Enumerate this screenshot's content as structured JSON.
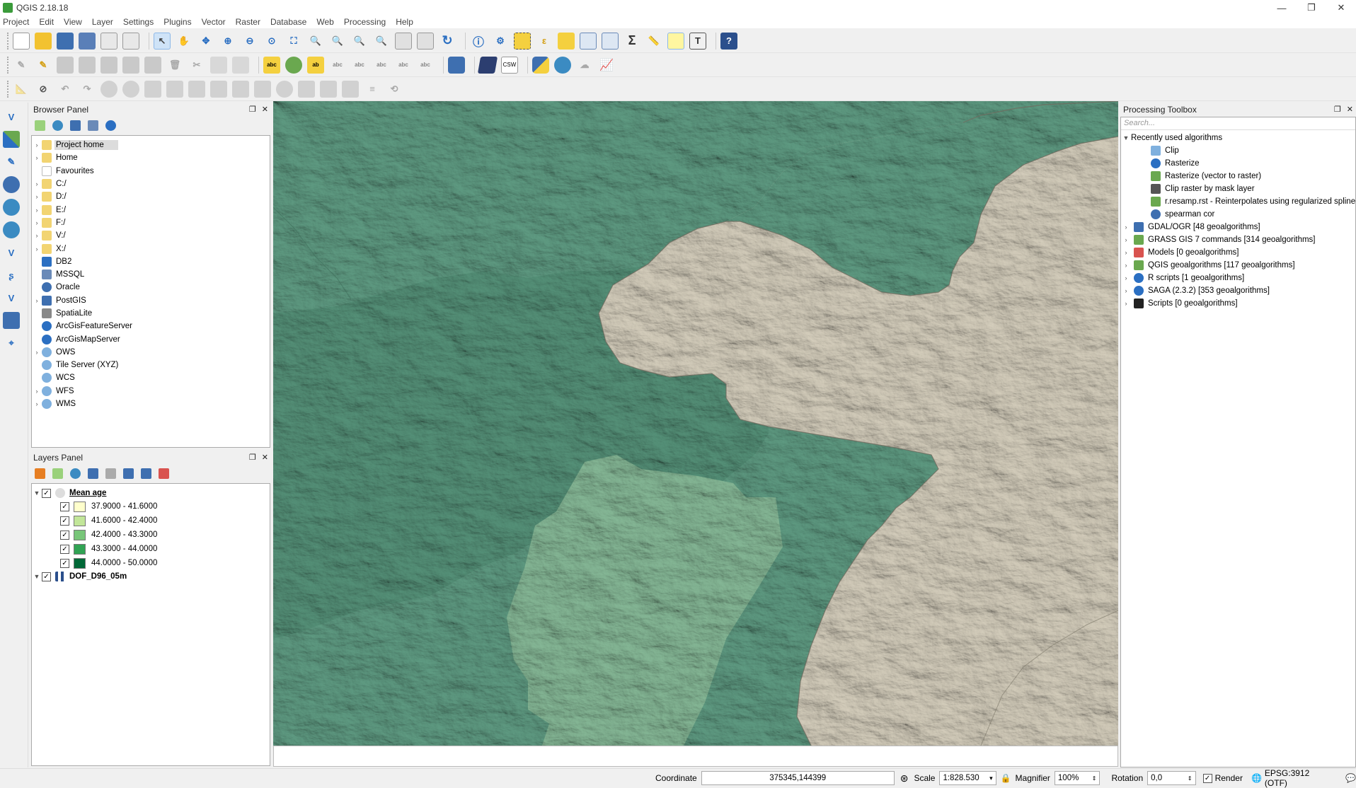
{
  "window": {
    "title": "QGIS 2.18.18",
    "minimize": "—",
    "restore": "❐",
    "close": "✕"
  },
  "menu": [
    "Project",
    "Edit",
    "View",
    "Layer",
    "Settings",
    "Plugins",
    "Vector",
    "Raster",
    "Database",
    "Web",
    "Processing",
    "Help"
  ],
  "toolbar": {
    "csw_label": "CSW",
    "abc_label": "abc"
  },
  "browser": {
    "title": "Browser Panel",
    "items": [
      {
        "label": "Project home",
        "icon": "folder-icon",
        "expandable": true
      },
      {
        "label": "Home",
        "icon": "folder-icon",
        "expandable": true
      },
      {
        "label": "Favourites",
        "icon": "star-icon",
        "expandable": false
      },
      {
        "label": "C:/",
        "icon": "folder-icon",
        "expandable": true
      },
      {
        "label": "D:/",
        "icon": "folder-icon",
        "expandable": true
      },
      {
        "label": "E:/",
        "icon": "folder-icon",
        "expandable": true
      },
      {
        "label": "F:/",
        "icon": "folder-icon",
        "expandable": true
      },
      {
        "label": "V:/",
        "icon": "folder-icon",
        "expandable": true
      },
      {
        "label": "X:/",
        "icon": "folder-icon",
        "expandable": true
      },
      {
        "label": "DB2",
        "icon": "db2-icon",
        "expandable": false
      },
      {
        "label": "MSSQL",
        "icon": "mssql-icon",
        "expandable": false
      },
      {
        "label": "Oracle",
        "icon": "oracle-icon",
        "expandable": false
      },
      {
        "label": "PostGIS",
        "icon": "postgis-icon",
        "expandable": true
      },
      {
        "label": "SpatiaLite",
        "icon": "spatialite-icon",
        "expandable": false
      },
      {
        "label": "ArcGisFeatureServer",
        "icon": "arcgis-icon",
        "expandable": false
      },
      {
        "label": "ArcGisMapServer",
        "icon": "arcgis-icon",
        "expandable": false
      },
      {
        "label": "OWS",
        "icon": "globe-icon",
        "expandable": true
      },
      {
        "label": "Tile Server (XYZ)",
        "icon": "globe-icon",
        "expandable": false
      },
      {
        "label": "WCS",
        "icon": "globe-icon",
        "expandable": false
      },
      {
        "label": "WFS",
        "icon": "globe-icon",
        "expandable": true
      },
      {
        "label": "WMS",
        "icon": "globe-icon",
        "expandable": true
      }
    ]
  },
  "layers": {
    "title": "Layers Panel",
    "group": {
      "name": "Mean age"
    },
    "classes": [
      {
        "label": "37.9000 - 41.6000",
        "color": "#ffffcc"
      },
      {
        "label": "41.6000 - 42.4000",
        "color": "#c2e699"
      },
      {
        "label": "42.4000 - 43.3000",
        "color": "#78c679"
      },
      {
        "label": "43.3000 - 44.0000",
        "color": "#31a354"
      },
      {
        "label": "44.0000 - 50.0000",
        "color": "#006837"
      }
    ],
    "raster": {
      "name": "DOF_D96_05m"
    }
  },
  "processing": {
    "title": "Processing Toolbox",
    "search_placeholder": "Search...",
    "recent": {
      "label": "Recently used algorithms",
      "items": [
        "Clip",
        "Rasterize",
        "Rasterize (vector to raster)",
        "Clip raster by mask layer",
        "r.resamp.rst - Reinterpolates using regularized spline ...",
        "spearman cor"
      ]
    },
    "providers": [
      "GDAL/OGR [48 geoalgorithms]",
      "GRASS GIS 7 commands [314 geoalgorithms]",
      "Models [0 geoalgorithms]",
      "QGIS geoalgorithms [117 geoalgorithms]",
      "R scripts [1 geoalgorithms]",
      "SAGA (2.3.2) [353 geoalgorithms]",
      "Scripts [0 geoalgorithms]"
    ]
  },
  "status": {
    "coordinate_label": "Coordinate",
    "coordinate_value": "375345,144399",
    "scale_label": "Scale",
    "scale_value": "1:828.530",
    "magnifier_label": "Magnifier",
    "magnifier_value": "100%",
    "rotation_label": "Rotation",
    "rotation_value": "0,0",
    "render_label": "Render",
    "crs_label": "EPSG:3912 (OTF)"
  }
}
